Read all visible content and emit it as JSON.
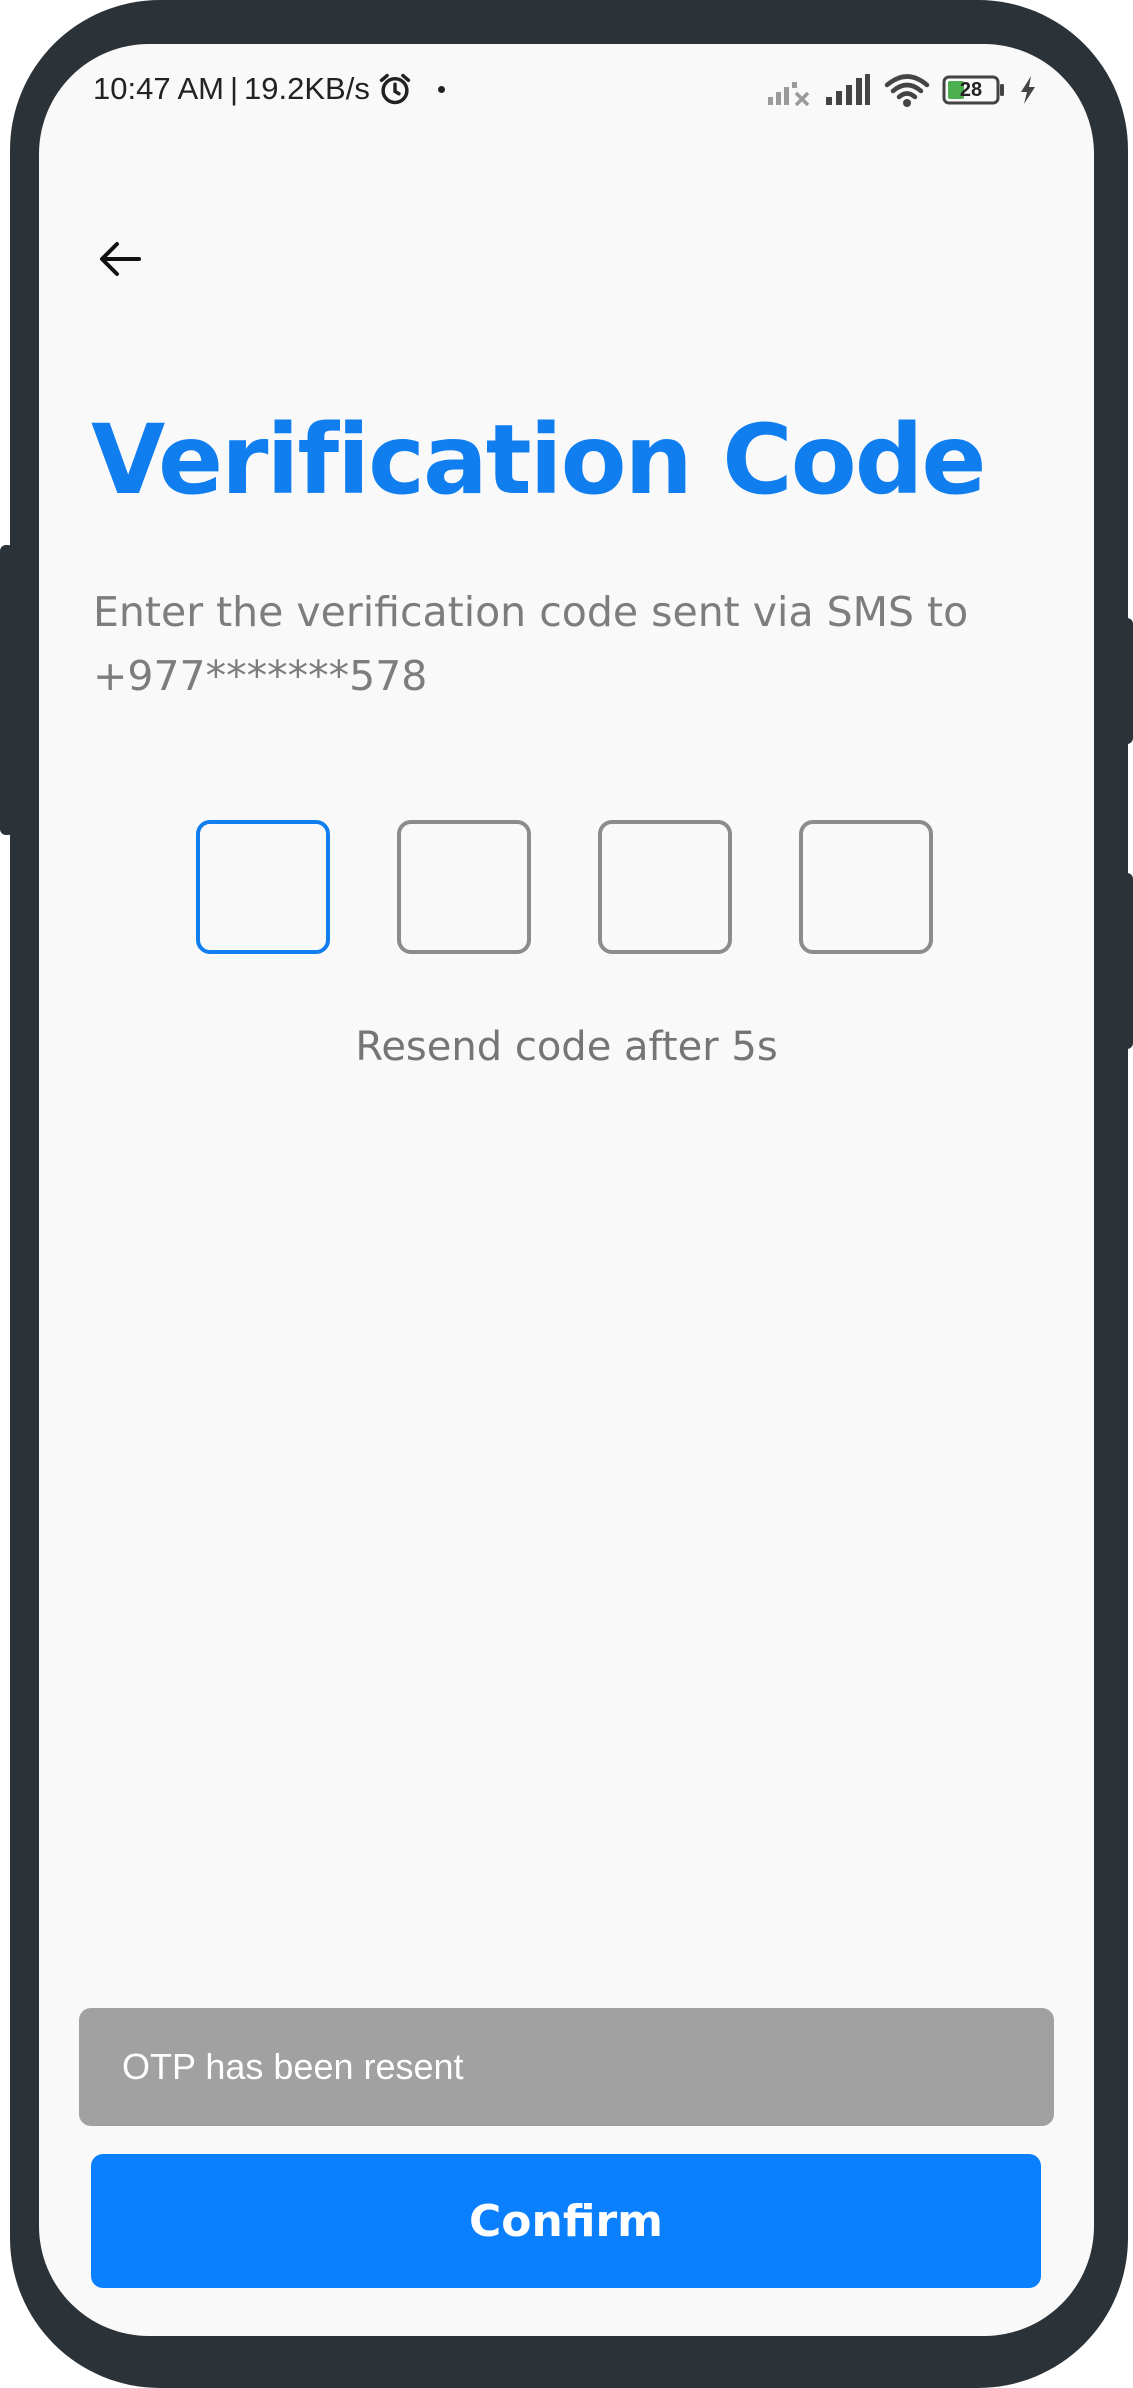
{
  "status_bar": {
    "time": "10:47 AM",
    "separator": "|",
    "network_speed": "19.2KB/s",
    "battery_level": "28",
    "icons": [
      "alarm-icon",
      "signal-off-icon",
      "signal-icon",
      "wifi-icon",
      "battery-icon",
      "charging-icon"
    ]
  },
  "header": {
    "back_icon": "arrow-left-icon"
  },
  "main": {
    "title": "Verification Code",
    "subtitle": "Enter the verification code sent via SMS to +977*******578",
    "otp": {
      "digits": [
        "",
        "",
        "",
        ""
      ],
      "active_index": 0
    },
    "resend_text": "Resend code after 5s"
  },
  "toast": {
    "message": "OTP has been resent"
  },
  "footer": {
    "confirm_label": "Confirm"
  },
  "colors": {
    "accent": "#117ef0",
    "button": "#0a80ff",
    "toast_bg": "#a1a1a1",
    "muted_text": "#7d7d7d",
    "frame": "#2c3338",
    "battery_fill": "#4caf50"
  }
}
